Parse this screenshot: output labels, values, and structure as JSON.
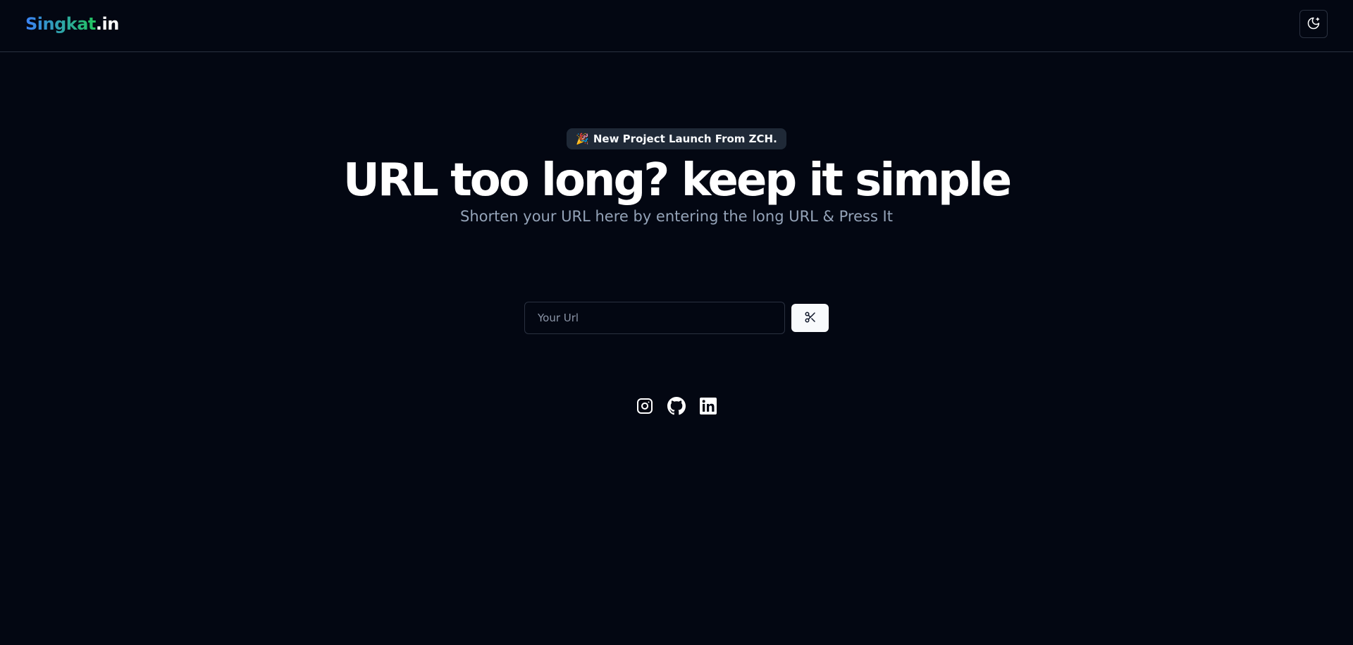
{
  "header": {
    "logo_main": "Singkat",
    "logo_tld": ".in",
    "theme_toggle_icon": "moon-stars-icon"
  },
  "hero": {
    "badge_emoji": "🎉",
    "badge_label": "New Project Launch From ZCH.",
    "headline": "URL too long? keep it simple",
    "subtitle": "Shorten your URL here by entering the long URL & Press It"
  },
  "form": {
    "url_placeholder": "Your Url",
    "url_value": "",
    "submit_icon": "scissors-icon"
  },
  "socials": [
    {
      "icon": "instagram-icon"
    },
    {
      "icon": "github-icon"
    },
    {
      "icon": "linkedin-icon"
    }
  ],
  "colors": {
    "background": "#030712",
    "logo_gradient_start": "#3b82f6",
    "logo_gradient_end": "#22c55e",
    "subtitle": "#94a3b8",
    "badge_bg": "#1f2937"
  }
}
